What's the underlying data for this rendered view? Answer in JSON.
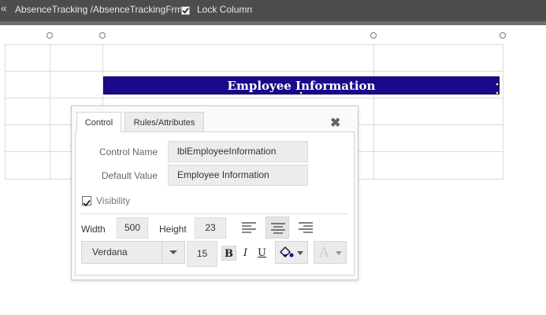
{
  "topbar": {
    "back_glyph": "«",
    "path": "AbsenceTracking /AbsenceTrackingFrm",
    "lock_column_label": "Lock Column",
    "lock_column_checked": true
  },
  "canvas": {
    "banner_text": "Employee Information",
    "banner_color": "#1a0a8a"
  },
  "dialog": {
    "tabs": [
      {
        "label": "Control",
        "active": true
      },
      {
        "label": "Rules/Attributes",
        "active": false
      }
    ],
    "close_glyph": "✖",
    "control_name_label": "Control Name",
    "control_name_value": "lblEmployeeInformation",
    "default_value_label": "Default Value",
    "default_value_value": "Employee Information",
    "visibility_label": "Visibility",
    "visibility_checked": true,
    "width_label": "Width",
    "width_value": "500",
    "height_label": "Height",
    "height_value": "23",
    "alignment_selected": "center",
    "font_family": "Verdana",
    "font_size": "15",
    "bold_glyph": "B",
    "italic_glyph": "I",
    "underline_glyph": "U",
    "text_color_glyph": "A"
  }
}
